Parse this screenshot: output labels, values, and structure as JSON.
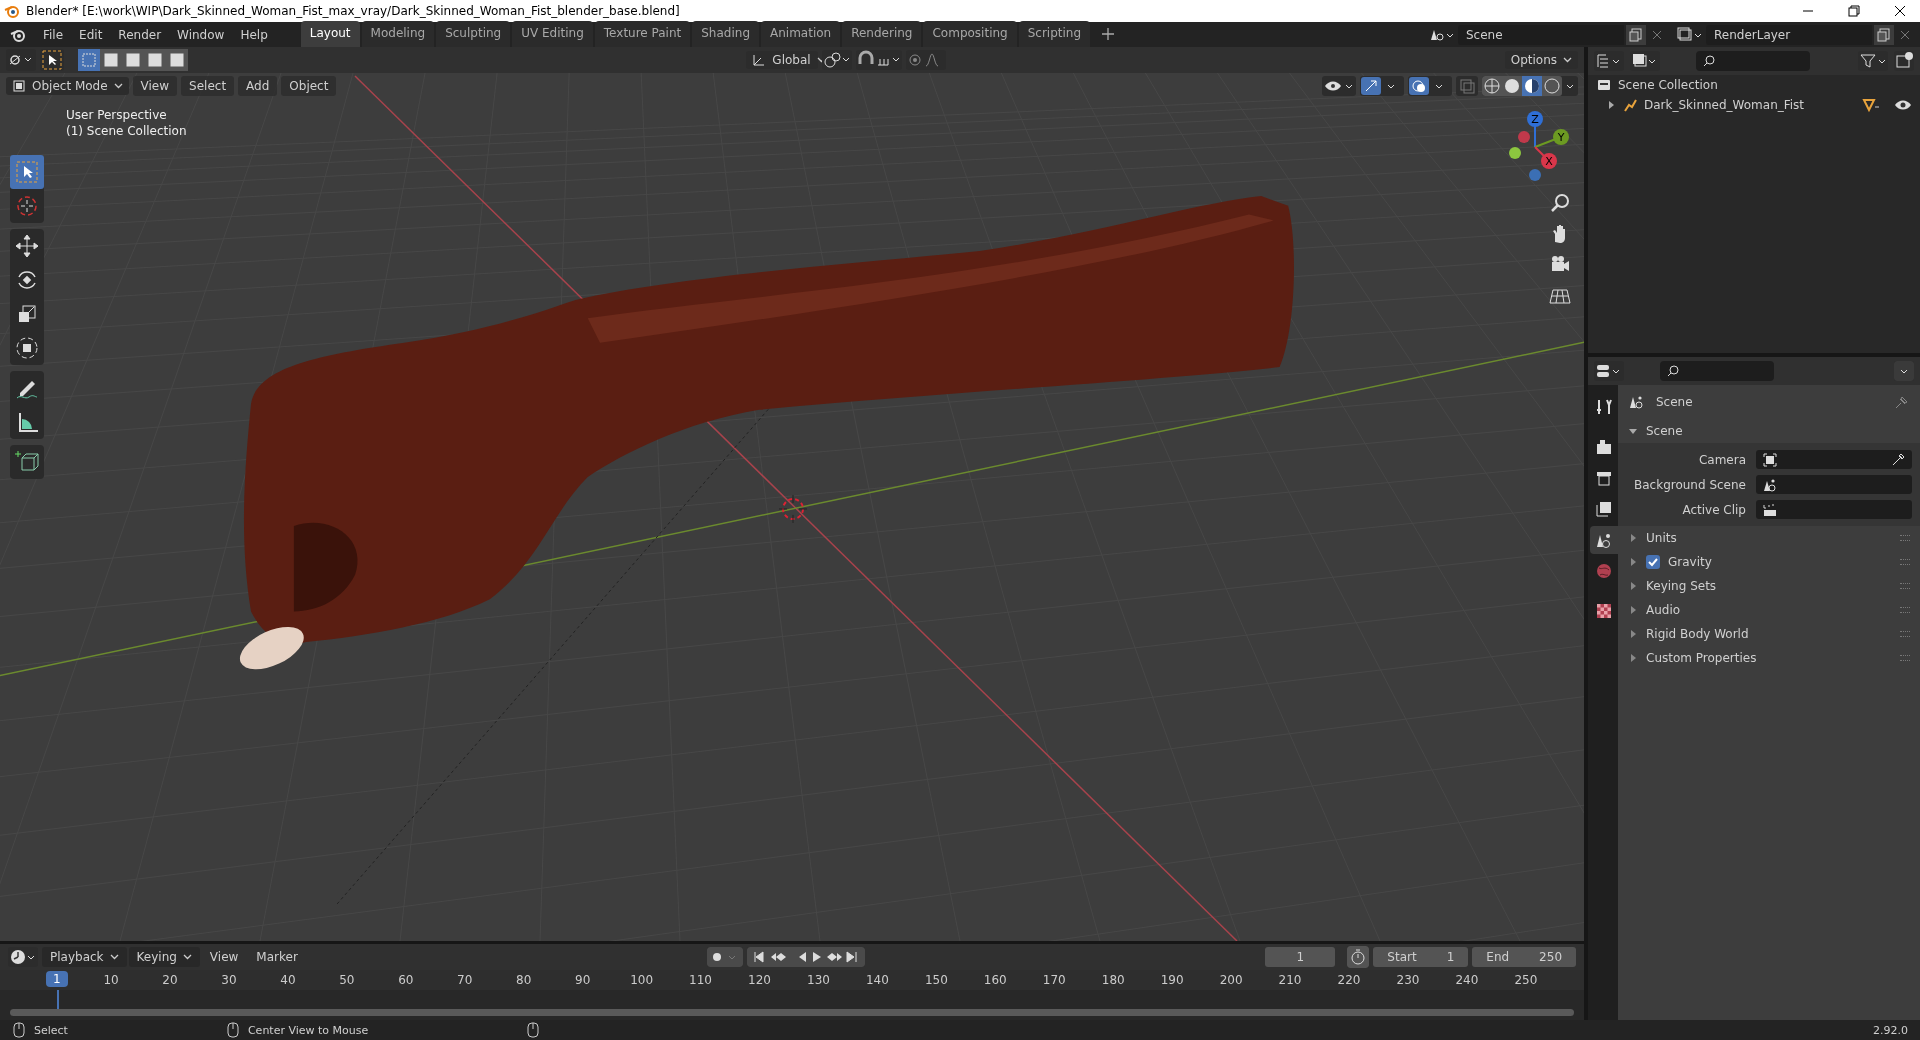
{
  "window": {
    "title": "Blender* [E:\\work\\WIP\\Dark_Skinned_Woman_Fist_max_vray/Dark_Skinned_Woman_Fist_blender_base.blend]"
  },
  "menu": [
    "File",
    "Edit",
    "Render",
    "Window",
    "Help"
  ],
  "workspaces": [
    {
      "label": "Layout",
      "selected": true
    },
    {
      "label": "Modeling",
      "selected": false
    },
    {
      "label": "Sculpting",
      "selected": false
    },
    {
      "label": "UV Editing",
      "selected": false
    },
    {
      "label": "Texture Paint",
      "selected": false
    },
    {
      "label": "Shading",
      "selected": false
    },
    {
      "label": "Animation",
      "selected": false
    },
    {
      "label": "Rendering",
      "selected": false
    },
    {
      "label": "Compositing",
      "selected": false
    },
    {
      "label": "Scripting",
      "selected": false
    }
  ],
  "scene_field": {
    "value": "Scene"
  },
  "view_layer_field": {
    "value": "RenderLayer"
  },
  "tool_header": {
    "select_modes": [
      {
        "selected": true
      },
      {
        "selected": false
      },
      {
        "selected": false
      },
      {
        "selected": false
      },
      {
        "selected": false
      }
    ],
    "orientation": "Global",
    "options": "Options"
  },
  "viewport": {
    "mode": "Object Mode",
    "menus": [
      "View",
      "Select",
      "Add",
      "Object"
    ],
    "overlay_text": [
      "User Perspective",
      "(1) Scene Collection"
    ],
    "tool_groups": [
      {
        "tools": [
          {
            "kind": "select",
            "selected": true
          },
          {
            "kind": "cursor",
            "selected": false
          }
        ]
      },
      {
        "tools": [
          {
            "kind": "move",
            "selected": false
          },
          {
            "kind": "rotate",
            "selected": false
          },
          {
            "kind": "scale",
            "selected": false
          },
          {
            "kind": "transform",
            "selected": false
          }
        ]
      },
      {
        "tools": [
          {
            "kind": "annotate",
            "selected": false
          },
          {
            "kind": "measure",
            "selected": false
          }
        ]
      },
      {
        "tools": [
          {
            "kind": "add_cube",
            "selected": false
          }
        ]
      }
    ],
    "gizmo_axes": [
      {
        "label": "Z",
        "color": "#2f6fd6"
      },
      {
        "label": "Y",
        "color": "#6c9a22"
      },
      {
        "label": "X",
        "color": "#d9364a"
      }
    ]
  },
  "outliner": {
    "root": "Scene Collection",
    "items": [
      {
        "label": "Dark_Skinned_Woman_Fist",
        "expanded": false
      }
    ]
  },
  "properties": {
    "tab_groups": [
      {
        "tabs": [
          {
            "kind": "tool",
            "selected": false
          }
        ]
      },
      {
        "tabs": [
          {
            "kind": "render",
            "selected": false
          },
          {
            "kind": "output",
            "selected": false
          },
          {
            "kind": "view_layer",
            "selected": false
          },
          {
            "kind": "scene",
            "selected": true
          },
          {
            "kind": "world",
            "selected": false
          }
        ]
      },
      {
        "tabs": [
          {
            "kind": "texture",
            "selected": false
          }
        ]
      }
    ],
    "header": "Scene",
    "section": {
      "label": "Scene",
      "expanded": true,
      "fields": [
        {
          "label": "Camera",
          "kind": "camera"
        },
        {
          "label": "Background Scene",
          "kind": "scene"
        },
        {
          "label": "Active Clip",
          "kind": "clip"
        }
      ]
    },
    "panels": [
      {
        "label": "Units",
        "kind": "plain"
      },
      {
        "label": "Gravity",
        "kind": "checkbox",
        "checked": true
      },
      {
        "label": "Keying Sets",
        "kind": "plain"
      },
      {
        "label": "Audio",
        "kind": "plain"
      },
      {
        "label": "Rigid Body World",
        "kind": "plain"
      },
      {
        "label": "Custom Properties",
        "kind": "plain"
      }
    ]
  },
  "timeline": {
    "menus": [
      {
        "label": "Playback",
        "dropdown": true
      },
      {
        "label": "Keying",
        "dropdown": true
      },
      {
        "label": "View",
        "dropdown": false
      },
      {
        "label": "Marker",
        "dropdown": false
      }
    ],
    "playhead": "1",
    "current_frame": "1",
    "start_label": "Start",
    "start": "1",
    "end_label": "End",
    "end": "250",
    "ruler": [
      "10",
      "20",
      "30",
      "40",
      "50",
      "60",
      "70",
      "80",
      "90",
      "100",
      "110",
      "120",
      "130",
      "140",
      "150",
      "160",
      "170",
      "180",
      "190",
      "200",
      "210",
      "220",
      "230",
      "240",
      "250"
    ]
  },
  "status_bar": {
    "hints": [
      "Select",
      "Center View to Mouse"
    ],
    "version": "2.92.0"
  }
}
